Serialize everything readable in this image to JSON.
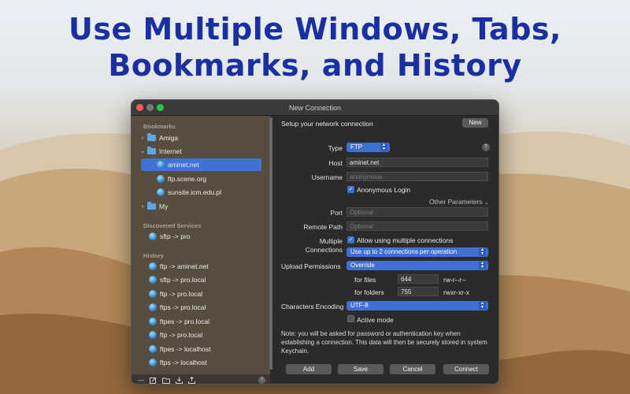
{
  "headline": {
    "line1": "Use Multiple Windows, Tabs,",
    "line2": "Bookmarks, and History"
  },
  "window": {
    "title": "New Connection"
  },
  "sidebar": {
    "bookmarks_header": "Bookmarks",
    "bookmarks": [
      {
        "label": "Amiga",
        "icon": "folder-icon",
        "expanded": false
      },
      {
        "label": "Internet",
        "icon": "folder-icon",
        "expanded": true
      },
      {
        "label": "aminet.net",
        "icon": "globe-icon",
        "selected": true
      },
      {
        "label": "ftp.scene.org",
        "icon": "globe-icon"
      },
      {
        "label": "sunsite.icm.edu.pl",
        "icon": "globe-icon"
      },
      {
        "label": "My",
        "icon": "folder-icon",
        "expanded": false
      }
    ],
    "discovered_header": "Discovered Services",
    "discovered": [
      {
        "label": "sftp -> pro"
      }
    ],
    "history_header": "History",
    "history": [
      {
        "label": "ftp -> aminet.net"
      },
      {
        "label": "sftp -> pro.local"
      },
      {
        "label": "ftp -> pro.local"
      },
      {
        "label": "ftps -> pro.local"
      },
      {
        "label": "ftpes -> pro.local"
      },
      {
        "label": "ftp -> pro.local"
      },
      {
        "label": "ftpes -> localhost"
      },
      {
        "label": "ftps -> localhost"
      }
    ],
    "toolbar_icons": [
      "minus-icon",
      "edit-icon",
      "new-folder-icon",
      "import-icon",
      "export-icon",
      "help-icon"
    ],
    "toolbar_labels": {
      "minus": "—",
      "help": "?"
    }
  },
  "form": {
    "setup_text": "Setup your network connection",
    "new_button": "New",
    "type_label": "Type",
    "type_value": "FTP",
    "host_label": "Host",
    "host_value": "aminet.net",
    "username_label": "Username",
    "username_placeholder": "anonymous",
    "anonymous_login": "Anonymous Login",
    "other_parameters": "Other Parameters",
    "port_label": "Port",
    "port_placeholder": "Optional",
    "remote_path_label": "Remote Path",
    "remote_path_placeholder": "Optional",
    "multiple_label_1": "Multiple",
    "multiple_label_2": "Connections",
    "allow_multiple": "Allow using multiple connections",
    "connections_value": "Use up to 2 connections per operation",
    "upload_permissions_label": "Upload Permissions",
    "upload_permissions_value": "Override",
    "for_files_label": "for files",
    "files_value": "644",
    "files_perm": "rw-r--r--",
    "for_folders_label": "for folders",
    "folders_value": "755",
    "folders_perm": "rwxr-xr-x",
    "encoding_label": "Characters Encoding",
    "encoding_value": "UTF-8",
    "active_mode": "Active mode",
    "note": "Note: you will be asked for password or authentication key when establishing a connection. This data will then be securely stored in system Keychain.",
    "help": "?"
  },
  "buttons": {
    "add": "Add",
    "save": "Save",
    "cancel": "Cancel",
    "connect": "Connect"
  },
  "colors": {
    "headline": "#1a2fa0",
    "accent": "#3f6fd1",
    "traffic_close": "#ff5f57",
    "traffic_minimize": "#febc2e",
    "traffic_zoom": "#28c840"
  }
}
